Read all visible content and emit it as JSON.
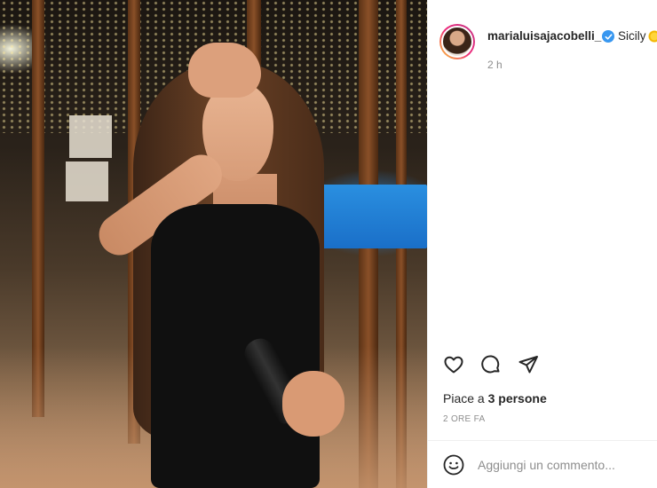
{
  "post": {
    "author": {
      "username": "marialuisajacobelli_",
      "verified": true,
      "location": "Sicily",
      "location_emoji": "sun-icon",
      "posted_ago": "2 h"
    },
    "actions": {
      "like_icon": "heart-icon",
      "comment_icon": "comment-icon",
      "share_icon": "share-icon"
    },
    "likes": {
      "prefix": "Piace a ",
      "count_text": "3 persone"
    },
    "date_label": "2 ORE FA",
    "comment_box": {
      "placeholder": "Aggiungi un commento...",
      "emoji_icon": "smiley-icon"
    },
    "colors": {
      "verified_badge": "#3897f0",
      "text_primary": "#262626",
      "text_secondary": "#8e8e8e",
      "divider": "#efefef"
    }
  }
}
